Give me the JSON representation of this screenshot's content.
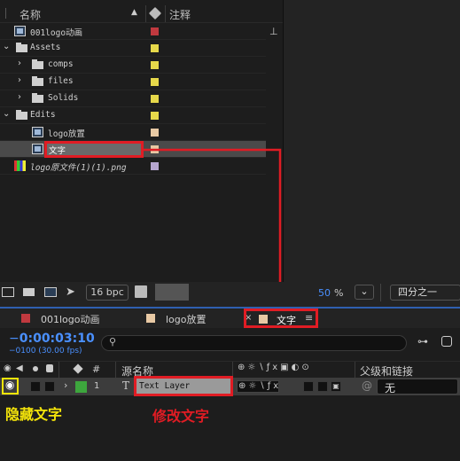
{
  "project_panel": {
    "col_name": "名称",
    "col_comment": "注释",
    "items": [
      {
        "label": "001logo动画",
        "type": "comp",
        "color": "#c0393f"
      },
      {
        "label": "Assets",
        "type": "folder",
        "color": "#e6d84a"
      },
      {
        "label": "comps",
        "type": "folder",
        "color": "#e6d84a"
      },
      {
        "label": "files",
        "type": "folder",
        "color": "#e6d84a"
      },
      {
        "label": "Solids",
        "type": "folder",
        "color": "#e6d84a"
      },
      {
        "label": "Edits",
        "type": "folder",
        "color": "#e6d84a"
      },
      {
        "label": "logo放置",
        "type": "comp",
        "color": "#e8c9a4"
      },
      {
        "label": "文字",
        "type": "comp",
        "color": "#e8c9a4"
      },
      {
        "label": "logo原文件(1)(1).png",
        "type": "image",
        "color": "#b6a6cf"
      }
    ],
    "bpc": "16 bpc"
  },
  "viewer": {
    "zoom": "50",
    "zoom_unit": "%",
    "resolution": "四分之一"
  },
  "comp_tabs": [
    {
      "label": "001logo动画",
      "color": "#c0393f"
    },
    {
      "label": "logo放置",
      "color": "#e8c9a4"
    },
    {
      "label": "文字",
      "color": "#e8c9a4",
      "active": true
    }
  ],
  "timeline": {
    "timecode": "0:00:03:10",
    "frame_info": "0100 (30.00 fps)",
    "search_placeholder": "",
    "col_source": "源名称",
    "col_hash": "#",
    "col_parent": "父级和链接",
    "layer": {
      "index": "1",
      "type_glyph": "T",
      "name": "Text Layer",
      "parent": "无",
      "label_color": "#3da63d"
    }
  },
  "annotations": {
    "hide_text": "隐藏文字",
    "edit_text": "修改文字"
  }
}
